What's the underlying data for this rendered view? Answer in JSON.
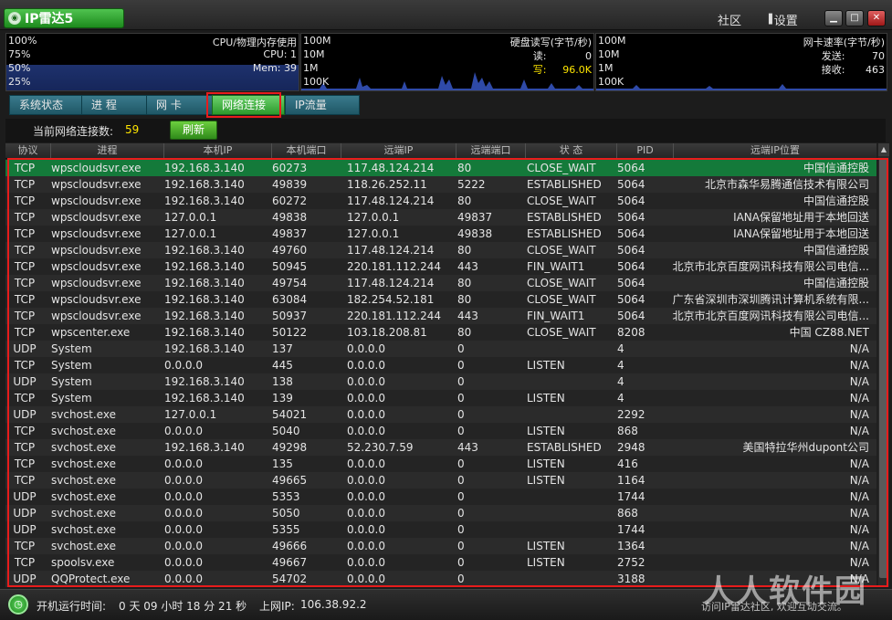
{
  "app": {
    "title": "IP雷达5",
    "logo_icon": "radar-icon"
  },
  "header": {
    "community": "社区",
    "settings": "设置"
  },
  "perf": {
    "cpu": {
      "r1_left": "100%",
      "r1_right": "CPU/物理内存使用",
      "r2_left": "75%",
      "r2_right": "CPU:   1",
      "r3_left": "50%",
      "r3_right": "Mem:  39",
      "r4_left": "25%"
    },
    "disk": {
      "r1_left": "100M",
      "r1_right": "硬盘读写(字节/秒)",
      "r2_left": "10M",
      "r2_label": "读:",
      "r2_value": "0",
      "r3_left": "1M",
      "r3_label": "写:",
      "r3_value": "96.0K",
      "r4_left": "100K"
    },
    "net": {
      "r1_left": "100M",
      "r1_right": "网卡速率(字节/秒)",
      "r2_left": "10M",
      "r2_label": "发送:",
      "r2_value": "70",
      "r3_left": "1M",
      "r3_label": "接收:",
      "r3_value": "463",
      "r4_left": "100K"
    }
  },
  "tabs": {
    "sys": "系统状态",
    "proc": "进 程",
    "nic": "网 卡",
    "conn": "网络连接",
    "flow": "IP流量"
  },
  "infobar": {
    "label": "当前网络连接数:",
    "count": "59",
    "refresh": "刷新"
  },
  "columns": {
    "proto": "协议",
    "proc": "进程",
    "lip": "本机IP",
    "lport": "本机端口",
    "rip": "远端IP",
    "rport": "远端端口",
    "state": "状 态",
    "pid": "PID",
    "loc": "远端IP位置"
  },
  "rows": [
    [
      "TCP",
      "wpscloudsvr.exe",
      "192.168.3.140",
      "60273",
      "117.48.124.214",
      "80",
      "CLOSE_WAIT",
      "5064",
      "中国信通控股"
    ],
    [
      "TCP",
      "wpscloudsvr.exe",
      "192.168.3.140",
      "49839",
      "118.26.252.11",
      "5222",
      "ESTABLISHED",
      "5064",
      "北京市森华易腾通信技术有限公司"
    ],
    [
      "TCP",
      "wpscloudsvr.exe",
      "192.168.3.140",
      "60272",
      "117.48.124.214",
      "80",
      "CLOSE_WAIT",
      "5064",
      "中国信通控股"
    ],
    [
      "TCP",
      "wpscloudsvr.exe",
      "127.0.0.1",
      "49838",
      "127.0.0.1",
      "49837",
      "ESTABLISHED",
      "5064",
      "IANA保留地址用于本地回送"
    ],
    [
      "TCP",
      "wpscloudsvr.exe",
      "127.0.0.1",
      "49837",
      "127.0.0.1",
      "49838",
      "ESTABLISHED",
      "5064",
      "IANA保留地址用于本地回送"
    ],
    [
      "TCP",
      "wpscloudsvr.exe",
      "192.168.3.140",
      "49760",
      "117.48.124.214",
      "80",
      "CLOSE_WAIT",
      "5064",
      "中国信通控股"
    ],
    [
      "TCP",
      "wpscloudsvr.exe",
      "192.168.3.140",
      "50945",
      "220.181.112.244",
      "443",
      "FIN_WAIT1",
      "5064",
      "北京市北京百度网讯科技有限公司电信..."
    ],
    [
      "TCP",
      "wpscloudsvr.exe",
      "192.168.3.140",
      "49754",
      "117.48.124.214",
      "80",
      "CLOSE_WAIT",
      "5064",
      "中国信通控股"
    ],
    [
      "TCP",
      "wpscloudsvr.exe",
      "192.168.3.140",
      "63084",
      "182.254.52.181",
      "80",
      "CLOSE_WAIT",
      "5064",
      "广东省深圳市深圳腾讯计算机系统有限..."
    ],
    [
      "TCP",
      "wpscloudsvr.exe",
      "192.168.3.140",
      "50937",
      "220.181.112.244",
      "443",
      "FIN_WAIT1",
      "5064",
      "北京市北京百度网讯科技有限公司电信..."
    ],
    [
      "TCP",
      "wpscenter.exe",
      "192.168.3.140",
      "50122",
      "103.18.208.81",
      "80",
      "CLOSE_WAIT",
      "8208",
      "中国 CZ88.NET"
    ],
    [
      "UDP",
      "System",
      "192.168.3.140",
      "137",
      "0.0.0.0",
      "0",
      "",
      "4",
      "N/A"
    ],
    [
      "TCP",
      "System",
      "0.0.0.0",
      "445",
      "0.0.0.0",
      "0",
      "LISTEN",
      "4",
      "N/A"
    ],
    [
      "UDP",
      "System",
      "192.168.3.140",
      "138",
      "0.0.0.0",
      "0",
      "",
      "4",
      "N/A"
    ],
    [
      "TCP",
      "System",
      "192.168.3.140",
      "139",
      "0.0.0.0",
      "0",
      "LISTEN",
      "4",
      "N/A"
    ],
    [
      "UDP",
      "svchost.exe",
      "127.0.0.1",
      "54021",
      "0.0.0.0",
      "0",
      "",
      "2292",
      "N/A"
    ],
    [
      "TCP",
      "svchost.exe",
      "0.0.0.0",
      "5040",
      "0.0.0.0",
      "0",
      "LISTEN",
      "868",
      "N/A"
    ],
    [
      "TCP",
      "svchost.exe",
      "192.168.3.140",
      "49298",
      "52.230.7.59",
      "443",
      "ESTABLISHED",
      "2948",
      "美国特拉华州dupont公司"
    ],
    [
      "TCP",
      "svchost.exe",
      "0.0.0.0",
      "135",
      "0.0.0.0",
      "0",
      "LISTEN",
      "416",
      "N/A"
    ],
    [
      "TCP",
      "svchost.exe",
      "0.0.0.0",
      "49665",
      "0.0.0.0",
      "0",
      "LISTEN",
      "1164",
      "N/A"
    ],
    [
      "UDP",
      "svchost.exe",
      "0.0.0.0",
      "5353",
      "0.0.0.0",
      "0",
      "",
      "1744",
      "N/A"
    ],
    [
      "UDP",
      "svchost.exe",
      "0.0.0.0",
      "5050",
      "0.0.0.0",
      "0",
      "",
      "868",
      "N/A"
    ],
    [
      "UDP",
      "svchost.exe",
      "0.0.0.0",
      "5355",
      "0.0.0.0",
      "0",
      "",
      "1744",
      "N/A"
    ],
    [
      "TCP",
      "svchost.exe",
      "0.0.0.0",
      "49666",
      "0.0.0.0",
      "0",
      "LISTEN",
      "1364",
      "N/A"
    ],
    [
      "TCP",
      "spoolsv.exe",
      "0.0.0.0",
      "49667",
      "0.0.0.0",
      "0",
      "LISTEN",
      "2752",
      "N/A"
    ],
    [
      "UDP",
      "QQProtect.exe",
      "0.0.0.0",
      "54702",
      "0.0.0.0",
      "0",
      "",
      "3188",
      "N/A"
    ]
  ],
  "status": {
    "uptime_label": "开机运行时间:",
    "uptime": "0 天 09 小时 18 分 21 秒",
    "ip_label": "上网IP:",
    "ip": "106.38.92.2",
    "link": "访问IP雷达社区, 欢迎互动交流。"
  },
  "watermark": "人人软件园"
}
